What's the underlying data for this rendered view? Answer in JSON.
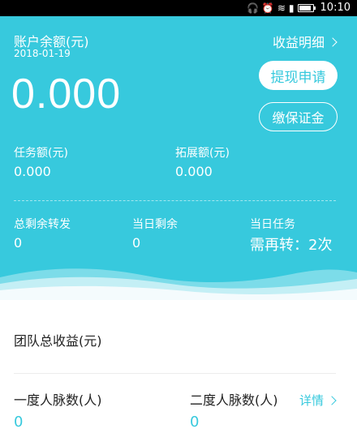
{
  "status_bar": {
    "time": "10:10",
    "icons": [
      "headset-icon",
      "alarm-icon",
      "wifi-icon",
      "signal-icon",
      "battery-icon"
    ]
  },
  "account": {
    "balance_label": "账户余额(元)",
    "date": "2018-01-19",
    "balance": "0.000",
    "income_detail_label": "收益明细",
    "withdraw_button": "提现申请",
    "deposit_button": "缴保证金"
  },
  "metrics": {
    "task_amount_label": "任务额(元)",
    "task_amount_value": "0.000",
    "expand_amount_label": "拓展额(元)",
    "expand_amount_value": "0.000"
  },
  "summary": {
    "total_remaining_label": "总剩余转发",
    "total_remaining_value": "0",
    "today_remaining_label": "当日剩余",
    "today_remaining_value": "0",
    "today_task_label": "当日任务",
    "today_task_value": "需再转：2次"
  },
  "team": {
    "title": "团队总收益(元)",
    "first_degree_label": "一度人脉数(人)",
    "first_degree_value": "0",
    "second_degree_label": "二度人脉数(人)",
    "second_degree_value": "0",
    "detail_label": "详情"
  },
  "colors": {
    "accent": "#37c9dd",
    "white": "#ffffff"
  }
}
